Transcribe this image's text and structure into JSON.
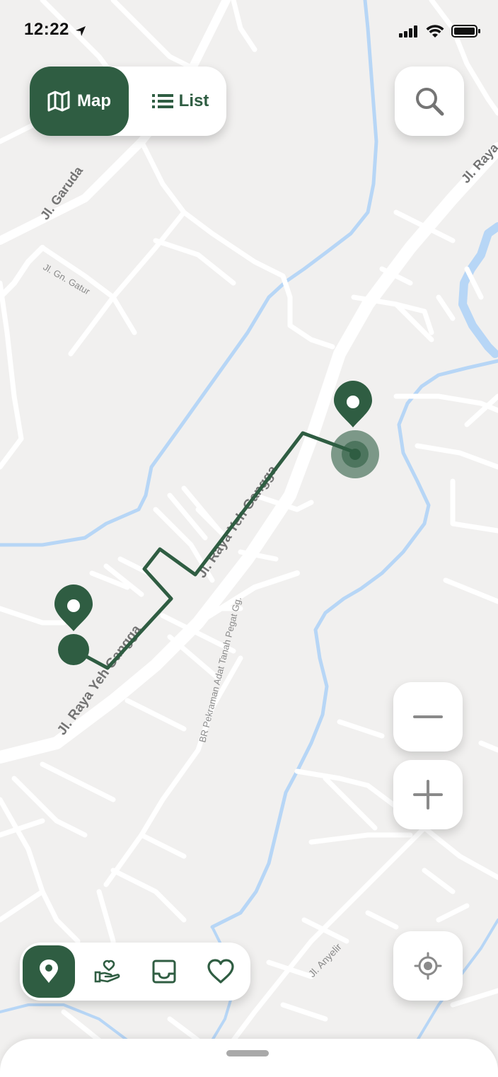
{
  "status_bar": {
    "time": "12:22"
  },
  "view_toggle": {
    "map_label": "Map",
    "list_label": "List",
    "selected": "Map"
  },
  "map": {
    "road_labels": {
      "garuda": "Jl. Garuda",
      "gn_gatur": "Jl. Gn. Gatur",
      "raya_top": "Jl. Raya",
      "raya_yeh_gangga_1": "Jl. Raya Yeh Gangga",
      "raya_yeh_gangga_2": "Jl. Raya Yeh Gangga",
      "br_pekraman": "BR Pekraman Adat Tanah Pegat Gg.",
      "anyelir": "Jl. Anyelir"
    },
    "colors": {
      "route": "#2f5d42",
      "marker": "#2f5d42",
      "water": "#b7d6f6",
      "road": "#ffffff",
      "land": "#f1f0ef"
    }
  },
  "icons": {
    "map_toggle": "map-icon",
    "list_toggle": "list-icon",
    "search": "search-icon",
    "zoom_out": "minus-icon",
    "zoom_in": "plus-icon",
    "locate": "crosshair-icon",
    "nav": [
      "location-pin-icon",
      "donate-hand-heart-icon",
      "inbox-icon",
      "heart-icon"
    ]
  },
  "bottom_nav": {
    "active": "location-pin-icon"
  }
}
